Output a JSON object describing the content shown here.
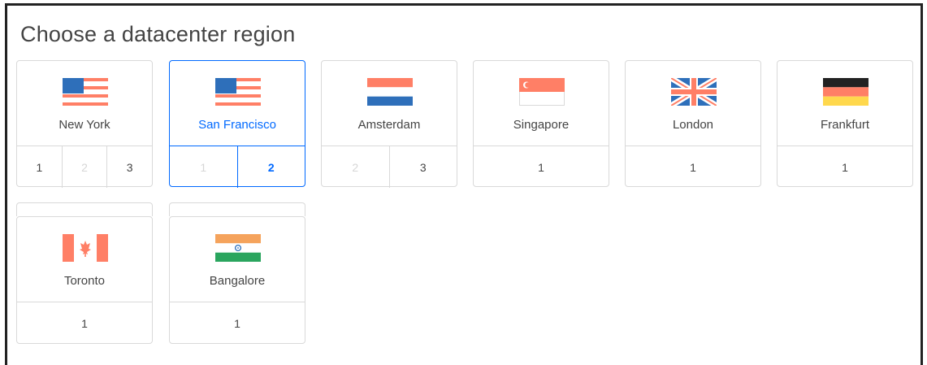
{
  "title": "Choose a datacenter region",
  "accent_color": "#0069ff",
  "regions": [
    {
      "name": "New York",
      "flag": "us-flag-icon",
      "datacenters": [
        {
          "label": "1",
          "state": "enabled"
        },
        {
          "label": "2",
          "state": "disabled"
        },
        {
          "label": "3",
          "state": "enabled"
        }
      ]
    },
    {
      "name": "San Francisco",
      "flag": "us-flag-icon",
      "selected": true,
      "datacenters": [
        {
          "label": "1",
          "state": "disabled"
        },
        {
          "label": "2",
          "state": "active"
        }
      ]
    },
    {
      "name": "Amsterdam",
      "flag": "netherlands-flag-icon",
      "datacenters": [
        {
          "label": "2",
          "state": "disabled"
        },
        {
          "label": "3",
          "state": "enabled"
        }
      ]
    },
    {
      "name": "Singapore",
      "flag": "singapore-flag-icon",
      "datacenters": [
        {
          "label": "1",
          "state": "enabled"
        }
      ]
    },
    {
      "name": "London",
      "flag": "uk-flag-icon",
      "datacenters": [
        {
          "label": "1",
          "state": "enabled"
        }
      ]
    },
    {
      "name": "Frankfurt",
      "flag": "germany-flag-icon",
      "datacenters": [
        {
          "label": "1",
          "state": "enabled"
        }
      ]
    },
    {
      "name": "Toronto",
      "flag": "canada-flag-icon",
      "datacenters": [
        {
          "label": "1",
          "state": "enabled"
        }
      ]
    },
    {
      "name": "Bangalore",
      "flag": "india-flag-icon",
      "datacenters": [
        {
          "label": "1",
          "state": "enabled"
        }
      ]
    }
  ]
}
